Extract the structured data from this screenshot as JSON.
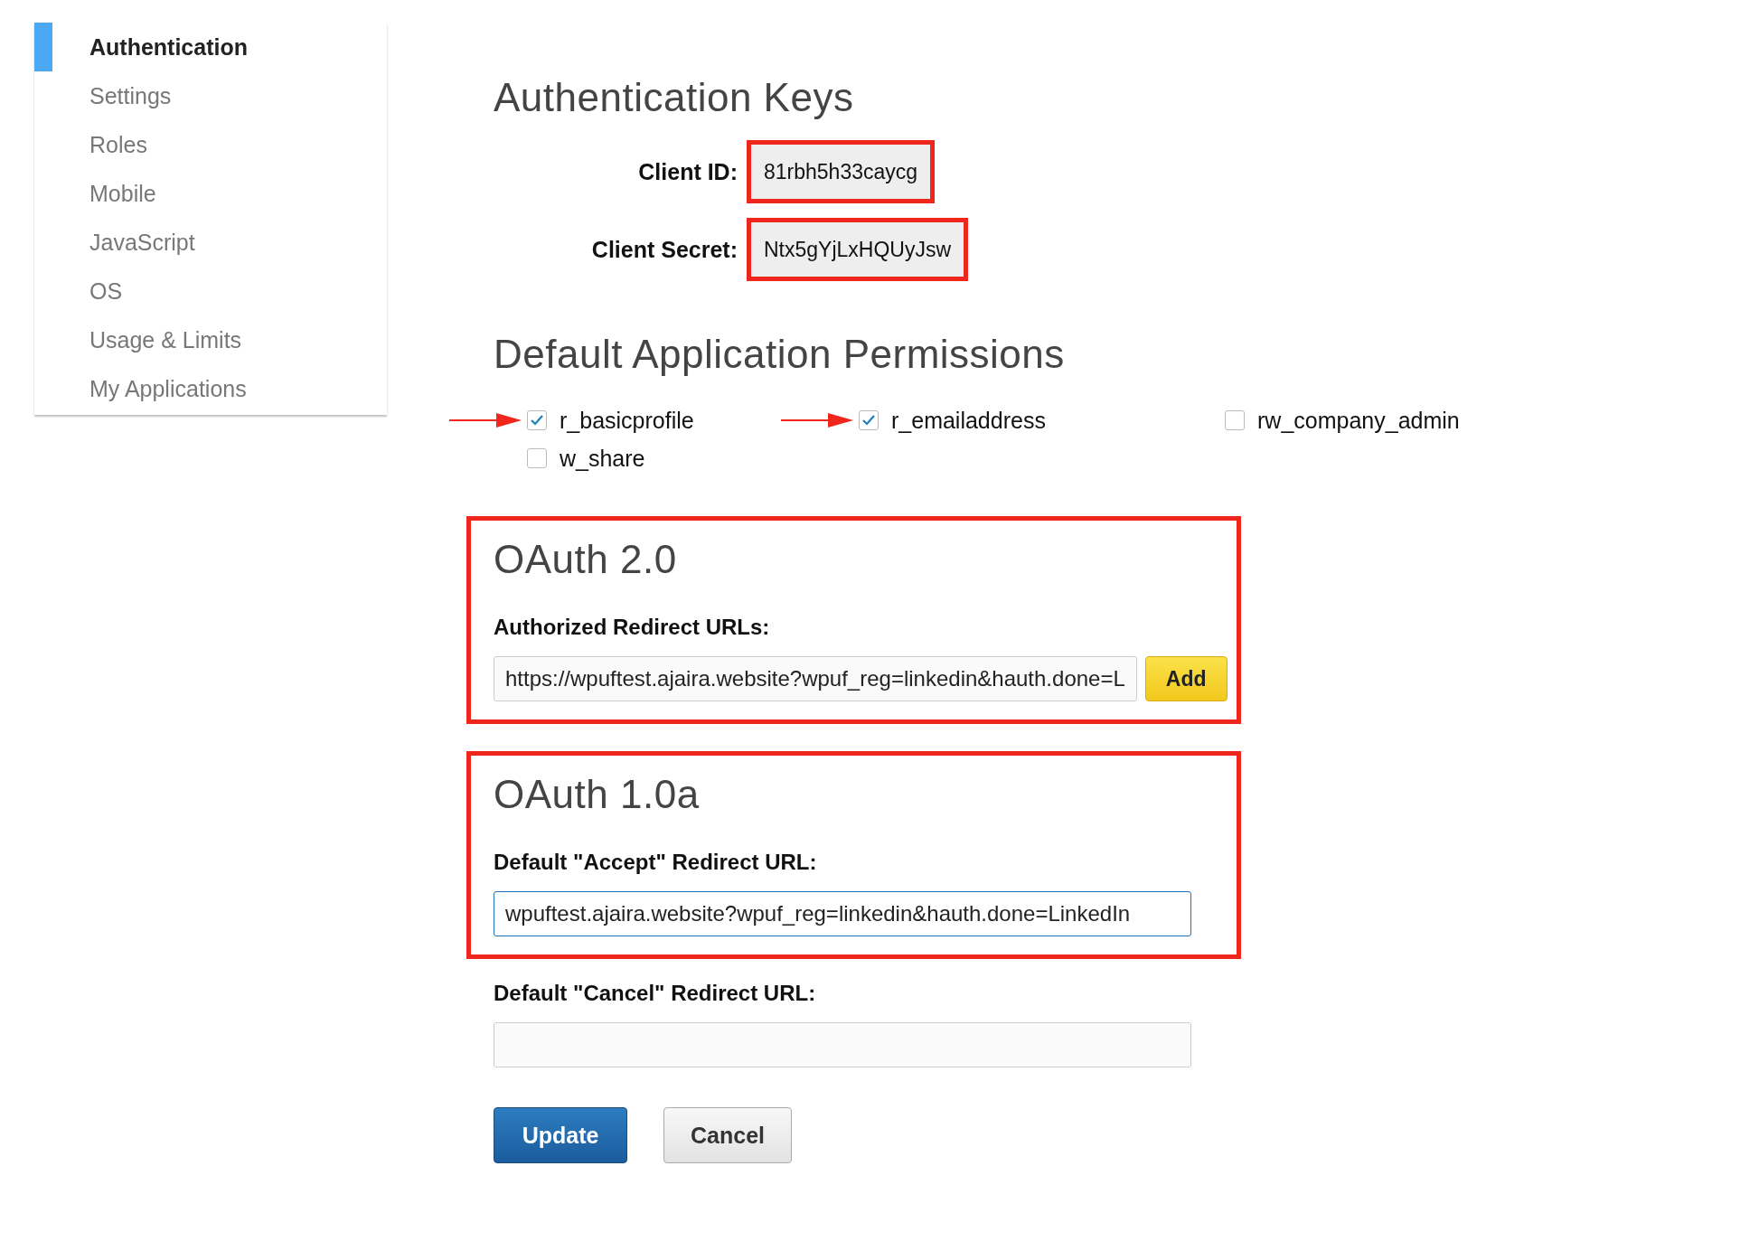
{
  "sidebar": {
    "items": [
      {
        "label": "Authentication",
        "selected": true
      },
      {
        "label": "Settings",
        "selected": false
      },
      {
        "label": "Roles",
        "selected": false
      },
      {
        "label": "Mobile",
        "selected": false
      },
      {
        "label": "JavaScript",
        "selected": false
      },
      {
        "label": "OS",
        "selected": false
      },
      {
        "label": "Usage & Limits",
        "selected": false
      },
      {
        "label": "My Applications",
        "selected": false
      }
    ]
  },
  "keys": {
    "title": "Authentication Keys",
    "fields": [
      {
        "label": "Client ID:",
        "value": "81rbh5h33caycg",
        "highlighted": true
      },
      {
        "label": "Client Secret:",
        "value": "Ntx5gYjLxHQUyJsw",
        "highlighted": true
      }
    ]
  },
  "permissions": {
    "title": "Default Application Permissions",
    "items": [
      {
        "label": "r_basicprofile",
        "checked": true,
        "arrow": true
      },
      {
        "label": "r_emailaddress",
        "checked": true,
        "arrow": true
      },
      {
        "label": "rw_company_admin",
        "checked": false,
        "arrow": false
      },
      {
        "label": "w_share",
        "checked": false,
        "arrow": false
      }
    ]
  },
  "sections": [
    {
      "title": "OAuth 2.0",
      "highlighted": true,
      "fields": [
        {
          "label": "Authorized Redirect URLs:",
          "value": "https://wpuftest.ajaira.website?wpuf_reg=linkedin&hauth.done=L",
          "focused": false,
          "button": "Add"
        }
      ]
    },
    {
      "title": "OAuth 1.0a",
      "highlighted": true,
      "fields": [
        {
          "label": "Default \"Accept\" Redirect URL:",
          "value": "wpuftest.ajaira.website?wpuf_reg=linkedin&hauth.done=LinkedIn",
          "focused": true
        }
      ]
    }
  ],
  "extra_fields": [
    {
      "label": "Default \"Cancel\" Redirect URL:",
      "focused": false
    }
  ],
  "buttons": [
    {
      "label": "Update",
      "kind": "primary"
    },
    {
      "label": "Cancel",
      "kind": "secondary"
    }
  ]
}
